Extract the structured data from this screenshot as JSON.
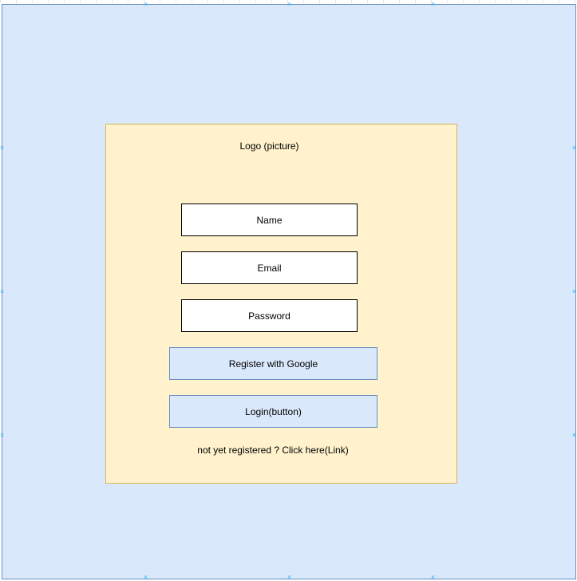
{
  "logo": {
    "label": "Logo (picture)"
  },
  "form": {
    "name_label": "Name",
    "email_label": "Email",
    "password_label": "Password"
  },
  "buttons": {
    "google_label": "Register with Google",
    "login_label": "Login(button)"
  },
  "footer": {
    "link_label": "not yet registered ? Click here(Link)"
  },
  "colors": {
    "canvas_fill": "#dae8fc",
    "canvas_stroke": "#6c8ebf",
    "card_fill": "#fff2cc",
    "card_stroke": "#d6b656",
    "handle": "#29b6f2"
  }
}
